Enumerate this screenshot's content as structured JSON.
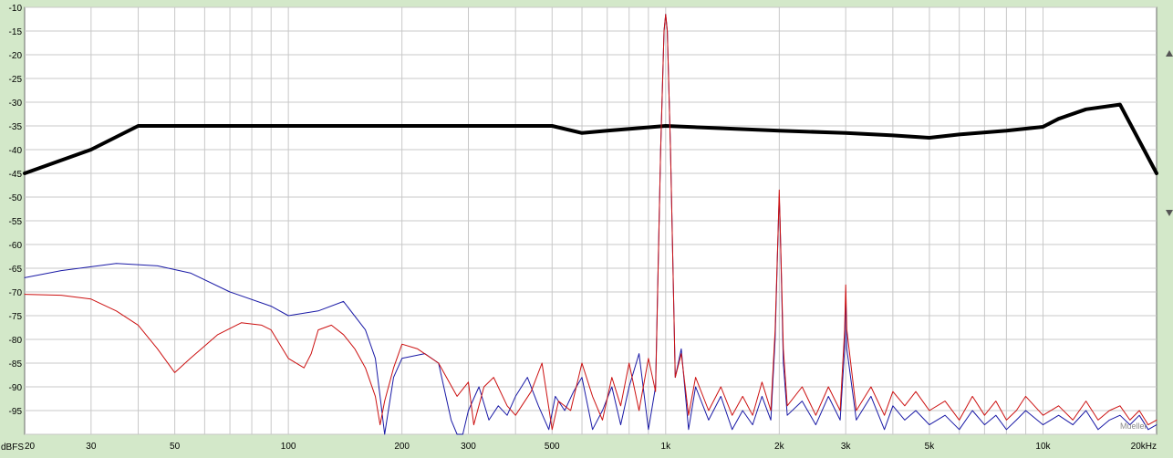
{
  "chart_data": {
    "type": "line",
    "xscale": "log",
    "xlim": [
      20,
      20000
    ],
    "ylim": [
      -100,
      -10
    ],
    "grid": true,
    "y_unit_label": "dBFS",
    "y_ticks": [
      -10,
      -15,
      -20,
      -25,
      -30,
      -35,
      -40,
      -45,
      -50,
      -55,
      -60,
      -65,
      -70,
      -75,
      -80,
      -85,
      -90,
      -95,
      -100
    ],
    "y_tick_labels": [
      "-10",
      "-15",
      "-20",
      "-25",
      "-30",
      "-35",
      "-40",
      "-45",
      "-50",
      "-55",
      "-60",
      "-65",
      "-70",
      "-75",
      "-80",
      "-85",
      "-90",
      "-95",
      ""
    ],
    "x_ticks": [
      20,
      30,
      50,
      100,
      200,
      300,
      500,
      1000,
      2000,
      3000,
      5000,
      10000,
      20000
    ],
    "x_tick_labels": [
      "20",
      "30",
      "50",
      "100",
      "200",
      "300",
      "500",
      "1k",
      "2k",
      "3k",
      "5k",
      "10k",
      "20kHz"
    ],
    "watermark": "Mueller",
    "series": [
      {
        "color": "#000000",
        "width": 4,
        "x": [
          20,
          30,
          40,
          500,
          600,
          700,
          1000,
          2000,
          3000,
          4000,
          5000,
          6000,
          8000,
          10000,
          11000,
          13000,
          16000,
          20000
        ],
        "y": [
          -45,
          -40,
          -35,
          -35,
          -36.5,
          -36,
          -35,
          -36,
          -36.5,
          -37,
          -37.5,
          -36.8,
          -36,
          -35.2,
          -33.5,
          -31.5,
          -30.5,
          -45
        ]
      },
      {
        "color": "#1a1aa6",
        "width": 1,
        "x": [
          20,
          25,
          35,
          45,
          55,
          70,
          90,
          100,
          120,
          140,
          160,
          170,
          175,
          180,
          190,
          200,
          230,
          250,
          270,
          280,
          290,
          300,
          320,
          340,
          360,
          380,
          400,
          430,
          460,
          490,
          510,
          540,
          570,
          600,
          640,
          680,
          720,
          760,
          800,
          850,
          900,
          940,
          970,
          990,
          1000,
          1010,
          1030,
          1060,
          1100,
          1150,
          1200,
          1300,
          1400,
          1500,
          1600,
          1700,
          1800,
          1900,
          1950,
          1990,
          2000,
          2010,
          2050,
          2100,
          2300,
          2500,
          2700,
          2900,
          2980,
          3000,
          3020,
          3200,
          3500,
          3800,
          4000,
          4300,
          4600,
          5000,
          5500,
          6000,
          6500,
          7000,
          7500,
          8000,
          8500,
          9000,
          10000,
          11000,
          12000,
          13000,
          14000,
          15000,
          16000,
          17000,
          18000,
          19000,
          20000
        ],
        "y": [
          -67,
          -65.5,
          -64,
          -64.5,
          -66,
          -70,
          -73,
          -75,
          -74,
          -72,
          -78,
          -84,
          -92,
          -100,
          -88,
          -84,
          -83,
          -85,
          -97,
          -100,
          -100,
          -95,
          -90,
          -97,
          -94,
          -96,
          -92,
          -88,
          -94,
          -99,
          -92,
          -95,
          -91,
          -88,
          -99,
          -95,
          -90,
          -98,
          -90,
          -83,
          -99,
          -90,
          -40,
          -15,
          -11.5,
          -15,
          -40,
          -88,
          -82,
          -99,
          -90,
          -97,
          -92,
          -99,
          -95,
          -98,
          -92,
          -97,
          -80,
          -55,
          -50,
          -55,
          -85,
          -96,
          -93,
          -98,
          -92,
          -97,
          -82,
          -70,
          -82,
          -97,
          -92,
          -99,
          -94,
          -97,
          -95,
          -98,
          -96,
          -99,
          -95,
          -98,
          -96,
          -99,
          -97,
          -95,
          -98,
          -96,
          -98,
          -95,
          -99,
          -97,
          -96,
          -98,
          -96,
          -99,
          -98
        ]
      },
      {
        "color": "#cc1111",
        "width": 1,
        "x": [
          20,
          25,
          30,
          35,
          40,
          45,
          50,
          55,
          65,
          75,
          85,
          90,
          100,
          110,
          115,
          120,
          130,
          140,
          150,
          160,
          170,
          175,
          180,
          190,
          200,
          220,
          250,
          280,
          300,
          310,
          330,
          350,
          380,
          400,
          440,
          470,
          500,
          520,
          560,
          600,
          640,
          680,
          720,
          760,
          800,
          850,
          900,
          940,
          970,
          990,
          1000,
          1010,
          1030,
          1060,
          1100,
          1150,
          1200,
          1300,
          1400,
          1500,
          1600,
          1700,
          1800,
          1900,
          1950,
          1990,
          2000,
          2010,
          2050,
          2100,
          2300,
          2500,
          2700,
          2900,
          2980,
          3000,
          3020,
          3200,
          3500,
          3800,
          4000,
          4300,
          4600,
          5000,
          5500,
          6000,
          6500,
          7000,
          7500,
          8000,
          8500,
          9000,
          10000,
          11000,
          12000,
          13000,
          14000,
          15000,
          16000,
          17000,
          18000,
          19000,
          20000
        ],
        "y": [
          -70.5,
          -70.7,
          -71.5,
          -74,
          -77,
          -82,
          -87,
          -84,
          -79,
          -76.5,
          -77,
          -78,
          -84,
          -86,
          -83,
          -78,
          -77,
          -79,
          -82,
          -86,
          -92,
          -98,
          -93,
          -86,
          -81,
          -82,
          -85,
          -92,
          -89,
          -98,
          -90,
          -88,
          -94,
          -96,
          -91,
          -85,
          -99,
          -93,
          -95,
          -85,
          -92,
          -97,
          -88,
          -94,
          -85,
          -95,
          -84,
          -91,
          -40,
          -15,
          -11.5,
          -15,
          -40,
          -88,
          -83,
          -96,
          -88,
          -95,
          -90,
          -96,
          -92,
          -96,
          -89,
          -95,
          -78,
          -55,
          -48.5,
          -55,
          -82,
          -94,
          -90,
          -96,
          -90,
          -95,
          -78,
          -68.5,
          -78,
          -95,
          -90,
          -96,
          -91,
          -94,
          -91,
          -95,
          -93,
          -97,
          -92,
          -96,
          -93,
          -97,
          -95,
          -92,
          -96,
          -94,
          -97,
          -93,
          -97,
          -95,
          -94,
          -97,
          -95,
          -98,
          -97
        ]
      }
    ]
  }
}
